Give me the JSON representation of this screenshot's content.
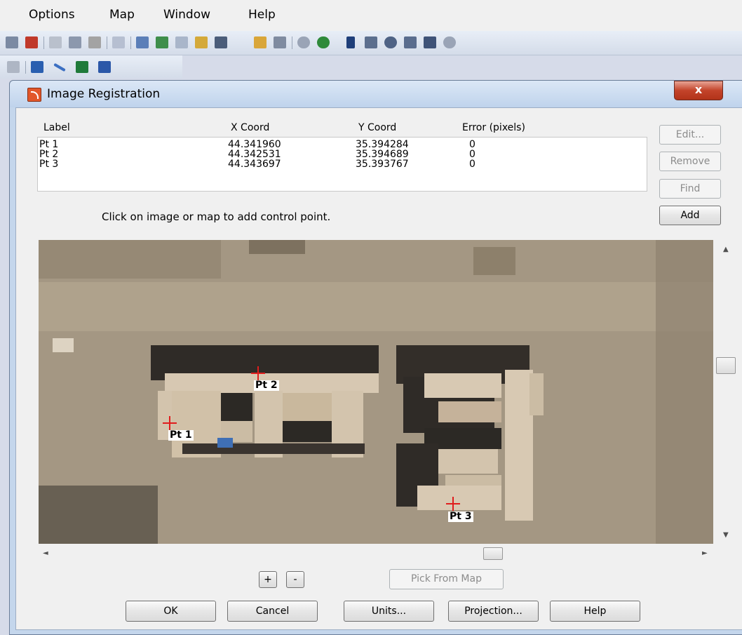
{
  "menubar": {
    "items": [
      "Options",
      "Map",
      "Window",
      "Help"
    ]
  },
  "toolbar": {
    "icons": [
      "print-icon",
      "print-preview-icon",
      "cut-icon",
      "copy-icon",
      "paste-icon",
      "undo-icon",
      "table-icon",
      "chart-icon",
      "grid-icon",
      "layout-icon",
      "export-icon",
      "open-table-icon",
      "clipboard-icon",
      "layer-icon",
      "globe-icon",
      "select-arrow-icon",
      "marquee-select-icon",
      "radius-select-icon",
      "polygon-select-icon",
      "boundary-select-icon",
      "unselect-icon",
      "reshape-icon",
      "add-node-icon",
      "line-style-icon",
      "region-style-icon",
      "text-style-icon"
    ]
  },
  "dialog": {
    "title": "Image Registration",
    "close_label": "x",
    "columns": [
      "Label",
      "X Coord",
      "Y Coord",
      "Error (pixels)"
    ],
    "control_points": [
      {
        "label": "Pt 1",
        "x": "44.341960",
        "y": "35.394284",
        "error": "0"
      },
      {
        "label": "Pt 2",
        "x": "44.342531",
        "y": "35.394689",
        "error": "0"
      },
      {
        "label": "Pt 3",
        "x": "44.343697",
        "y": "35.393767",
        "error": "0"
      }
    ],
    "side_buttons": {
      "edit": "Edit...",
      "remove": "Remove",
      "find": "Find",
      "add": "Add"
    },
    "hint": "Click on image or map to add control point.",
    "image_labels": {
      "pt1": "Pt 1",
      "pt2": "Pt 2",
      "pt3": "Pt 3"
    },
    "zoom_in": "+",
    "zoom_out": "-",
    "pick_from_map": "Pick From Map",
    "bottom_buttons": {
      "ok": "OK",
      "cancel": "Cancel",
      "units": "Units...",
      "projection": "Projection...",
      "help": "Help"
    }
  }
}
